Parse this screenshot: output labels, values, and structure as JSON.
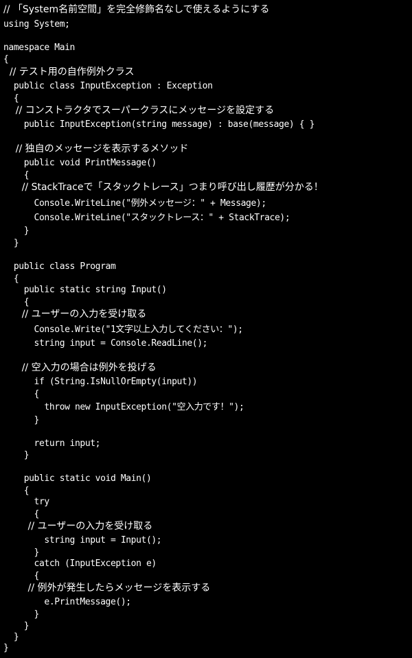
{
  "code_lines": [
    {
      "text": "// 「System名前空間」を完全修飾名なしで使えるようにする",
      "comment": true
    },
    {
      "text": "using System;"
    },
    {
      "text": ""
    },
    {
      "text": "namespace Main"
    },
    {
      "text": "{"
    },
    {
      "text": "  // テスト用の自作例外クラス",
      "comment": true
    },
    {
      "text": "  public class InputException : Exception"
    },
    {
      "text": "  {"
    },
    {
      "text": "    // コンストラクタでスーパークラスにメッセージを設定する",
      "comment": true
    },
    {
      "text": "    public InputException(string message) : base(message) { }"
    },
    {
      "text": ""
    },
    {
      "text": "    // 独自のメッセージを表示するメソッド",
      "comment": true
    },
    {
      "text": "    public void PrintMessage()"
    },
    {
      "text": "    {"
    },
    {
      "text": "      // StackTraceで「スタックトレース」つまり呼び出し履歴が分かる！",
      "comment": true
    },
    {
      "text": "      Console.WriteLine(\"例外メッセージ：\" + Message);"
    },
    {
      "text": "      Console.WriteLine(\"スタックトレース：\" + StackTrace);"
    },
    {
      "text": "    }"
    },
    {
      "text": "  }"
    },
    {
      "text": ""
    },
    {
      "text": "  public class Program"
    },
    {
      "text": "  {"
    },
    {
      "text": "    public static string Input()"
    },
    {
      "text": "    {"
    },
    {
      "text": "      // ユーザーの入力を受け取る",
      "comment": true
    },
    {
      "text": "      Console.Write(\"1文字以上入力してください：\");"
    },
    {
      "text": "      string input = Console.ReadLine();"
    },
    {
      "text": ""
    },
    {
      "text": "      // 空入力の場合は例外を投げる",
      "comment": true
    },
    {
      "text": "      if (String.IsNullOrEmpty(input))"
    },
    {
      "text": "      {"
    },
    {
      "text": "        throw new InputException(\"空入力です！\");"
    },
    {
      "text": "      }"
    },
    {
      "text": ""
    },
    {
      "text": "      return input;"
    },
    {
      "text": "    }"
    },
    {
      "text": ""
    },
    {
      "text": "    public static void Main()"
    },
    {
      "text": "    {"
    },
    {
      "text": "      try"
    },
    {
      "text": "      {"
    },
    {
      "text": "        // ユーザーの入力を受け取る",
      "comment": true
    },
    {
      "text": "        string input = Input();"
    },
    {
      "text": "      }"
    },
    {
      "text": "      catch (InputException e)"
    },
    {
      "text": "      {"
    },
    {
      "text": "        // 例外が発生したらメッセージを表示する",
      "comment": true
    },
    {
      "text": "        e.PrintMessage();"
    },
    {
      "text": "      }"
    },
    {
      "text": "    }"
    },
    {
      "text": "  }"
    },
    {
      "text": "}"
    }
  ]
}
